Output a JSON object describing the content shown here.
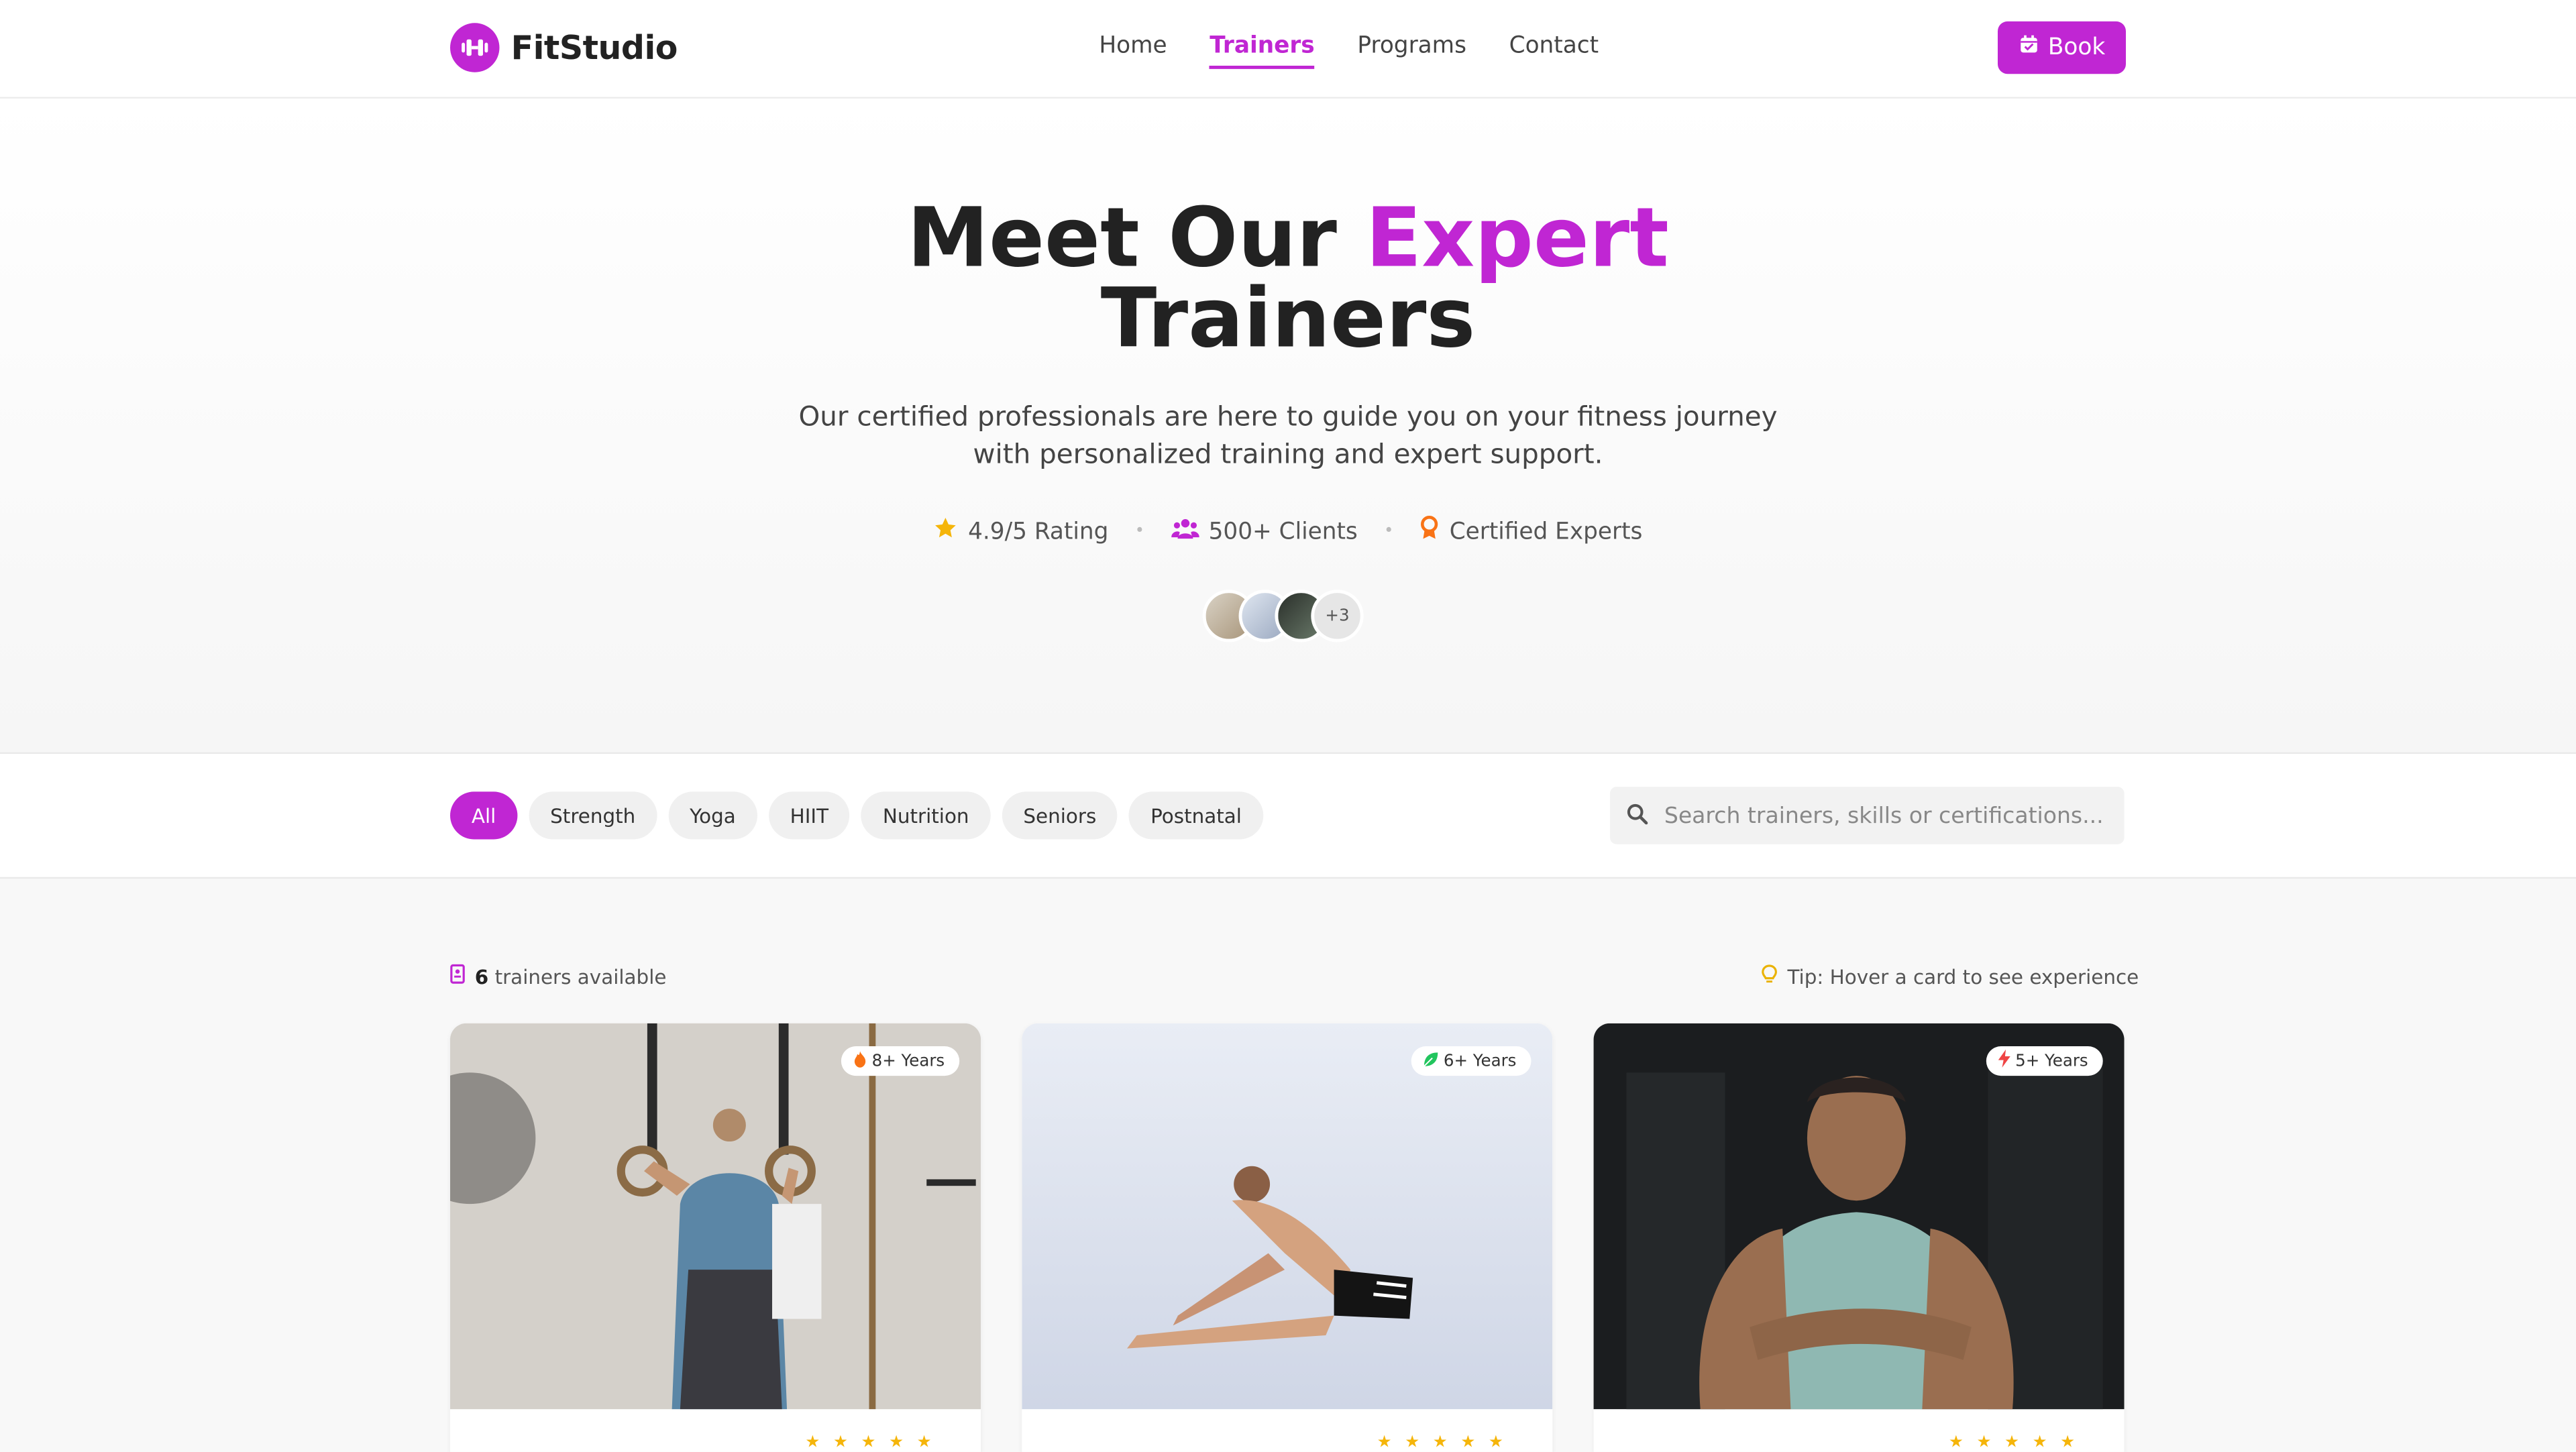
{
  "header": {
    "brand": "FitStudio",
    "nav": [
      {
        "label": "Home",
        "active": false
      },
      {
        "label": "Trainers",
        "active": true
      },
      {
        "label": "Programs",
        "active": false
      },
      {
        "label": "Contact",
        "active": false
      }
    ],
    "book_label": "Book",
    "icons": {
      "logo": "dumbbell-icon",
      "book": "calendar-icon"
    }
  },
  "hero": {
    "title_part1": "Meet Our ",
    "title_accent": "Expert",
    "title_part2": "Trainers",
    "subtitle": "Our certified professionals are here to guide you on your fitness journey with personalized training and expert support.",
    "stats": [
      {
        "icon": "star-icon",
        "label": "4.9/5 Rating"
      },
      {
        "icon": "users-icon",
        "label": "500+ Clients"
      },
      {
        "icon": "award-icon",
        "label": "Certified Experts"
      }
    ],
    "separator": "•",
    "more_trainers": "+3"
  },
  "filters": {
    "chips": [
      {
        "label": "All",
        "active": true
      },
      {
        "label": "Strength",
        "active": false
      },
      {
        "label": "Yoga",
        "active": false
      },
      {
        "label": "HIIT",
        "active": false
      },
      {
        "label": "Nutrition",
        "active": false
      },
      {
        "label": "Seniors",
        "active": false
      },
      {
        "label": "Postnatal",
        "active": false
      }
    ],
    "search_placeholder": "Search trainers, skills or certifications...",
    "search_value": ""
  },
  "results": {
    "count": "6",
    "count_suffix": " trainers available",
    "tip": "Tip: Hover a card to see experience"
  },
  "cards": [
    {
      "badge": "8+ Years",
      "badge_icon": "flame-icon",
      "rating": 5
    },
    {
      "badge": "6+ Years",
      "badge_icon": "leaf-icon",
      "rating": 5
    },
    {
      "badge": "5+ Years",
      "badge_icon": "bolt-icon",
      "rating": 5
    }
  ],
  "star_glyphs": "★★★★★",
  "colors": {
    "accent": "#c026d3",
    "star": "#f5b50a",
    "award": "#f97316"
  }
}
